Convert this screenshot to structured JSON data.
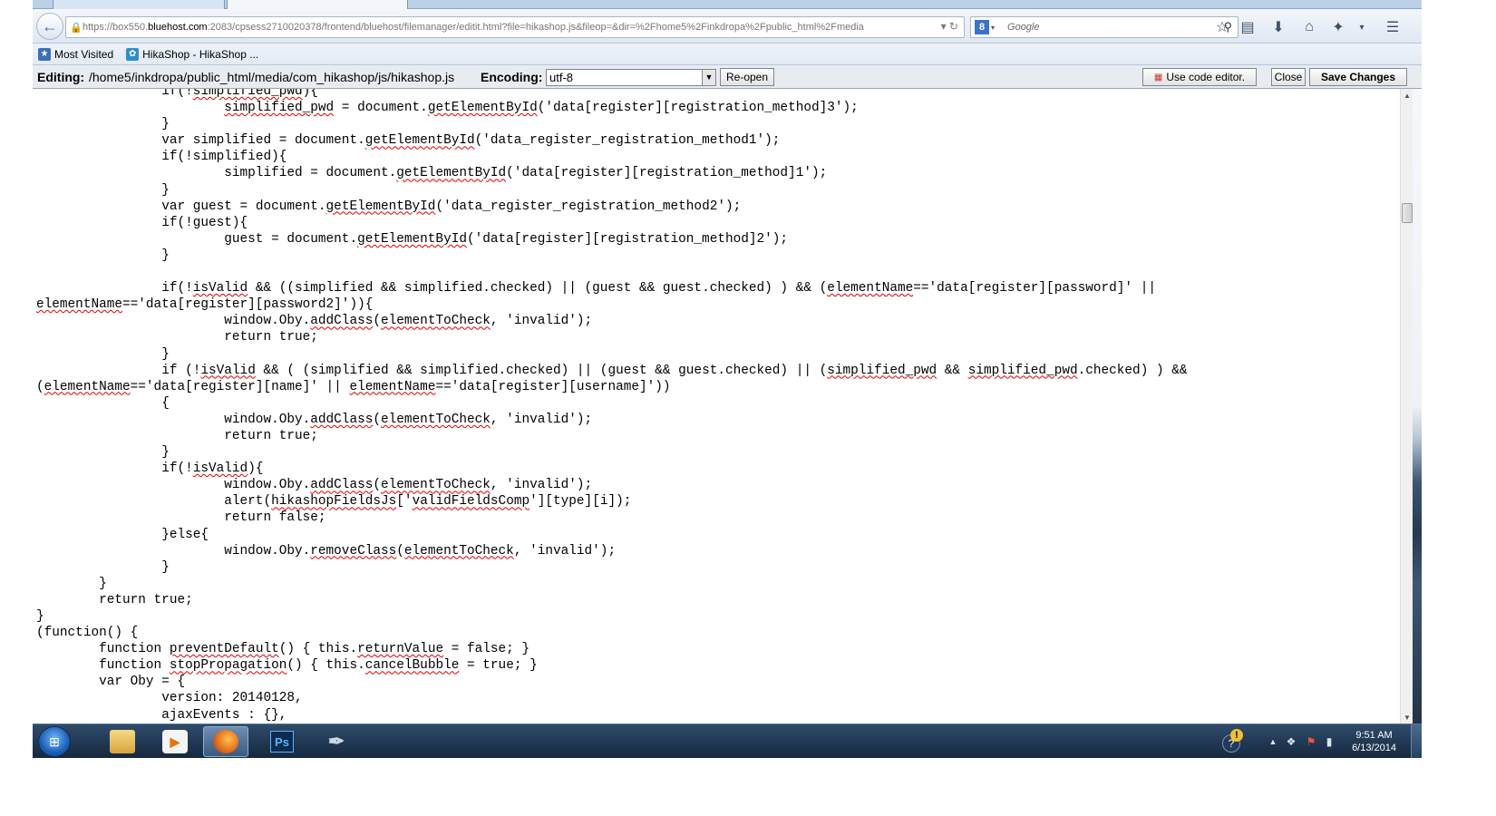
{
  "browser": {
    "url": {
      "scheme": "https://box550.",
      "host": "bluehost.com",
      "rest": ":2083/cpsess2710020378/frontend/bluehost/filemanager/editit.html?file=hikashop.js&fileop=&dir=%2Fhome5%2Finkdropa%2Fpublic_html%2Fmedia"
    },
    "search": {
      "engine_letter": "8",
      "placeholder": "Google"
    }
  },
  "bookmarks": [
    {
      "label": "Most Visited"
    },
    {
      "label": "HikaShop - HikaShop ..."
    }
  ],
  "editor": {
    "editing_label": "Editing:",
    "file_path": "/home5/inkdropa/public_html/media/com_hikashop/js/hikashop.js",
    "encoding_label": "Encoding:",
    "encoding_value": "utf-8",
    "reopen_label": "Re-open",
    "code_editor_label": "Use code editor.",
    "close_label": "Close",
    "save_label": "Save Changes"
  },
  "taskbar": {
    "start_label": "⊞",
    "ps_label": "Ps",
    "clock_time": "9:51 AM",
    "clock_date": "6/13/2014"
  },
  "colors": {
    "spellcheck": "#e00000",
    "taskbar": "#1f3550"
  }
}
